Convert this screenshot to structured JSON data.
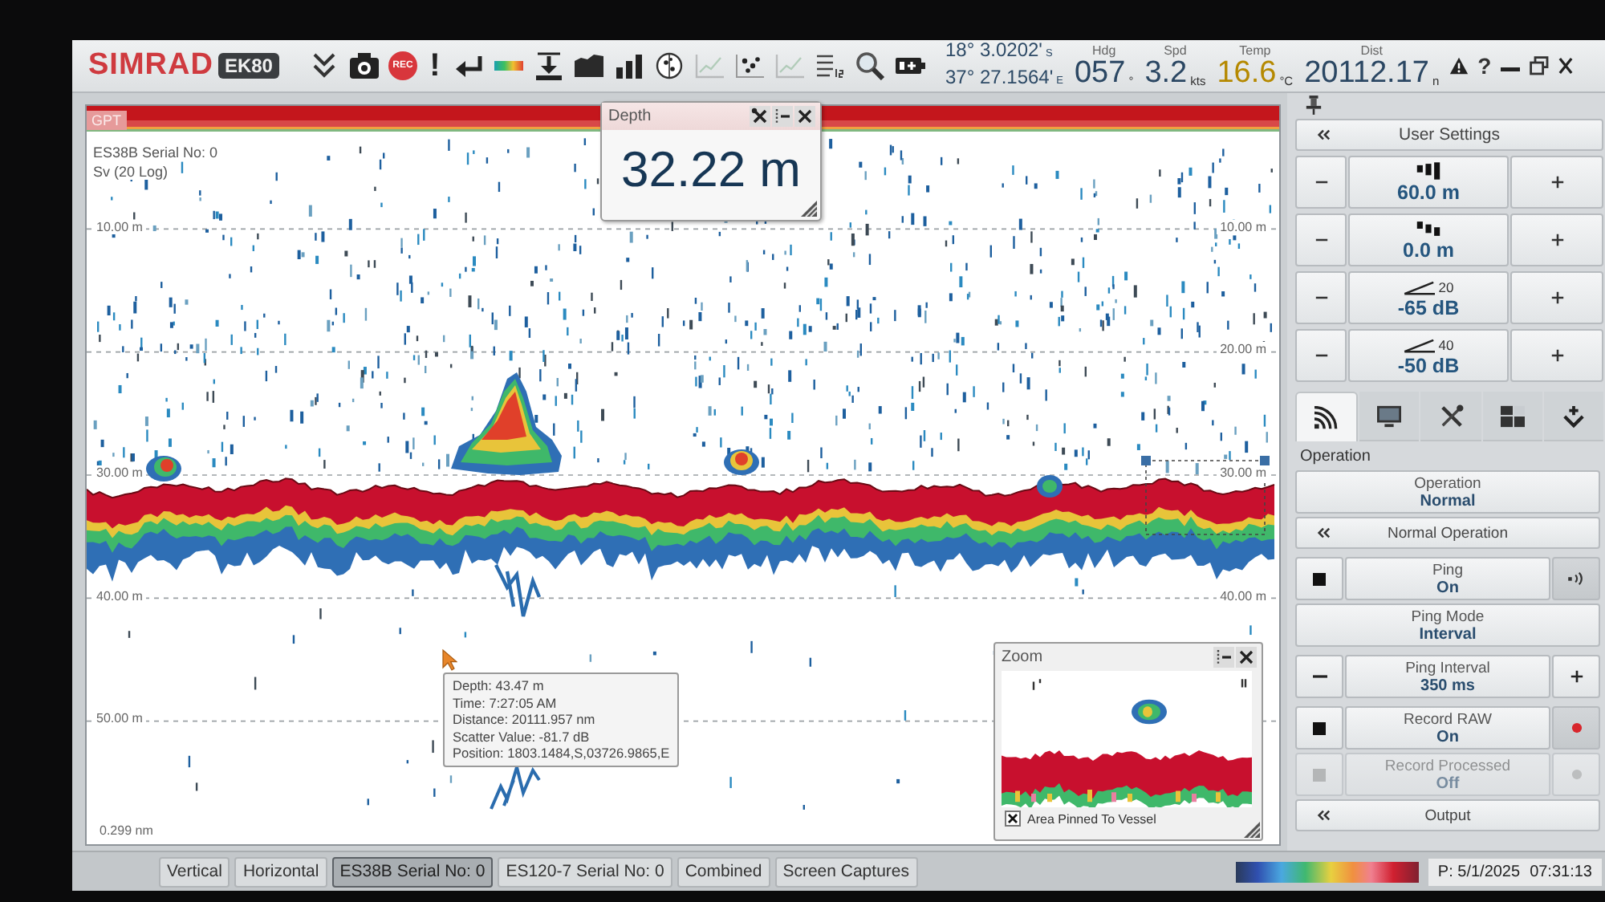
{
  "toolbar": {
    "brand": "SIMRAD",
    "product": "EK80",
    "buttons": [
      {
        "kind": "collapse",
        "disabled": false
      },
      {
        "kind": "camera",
        "disabled": false
      },
      {
        "kind": "record",
        "label": "REC",
        "disabled": false
      },
      {
        "kind": "alarm",
        "label": "!",
        "disabled": false
      },
      {
        "kind": "return",
        "disabled": false
      },
      {
        "kind": "colors",
        "disabled": false
      },
      {
        "kind": "bottom",
        "disabled": false
      },
      {
        "kind": "echogram",
        "disabled": false
      },
      {
        "kind": "histogram",
        "disabled": false
      },
      {
        "kind": "targets",
        "disabled": false
      },
      {
        "kind": "graph",
        "disabled": true
      },
      {
        "kind": "scatter",
        "disabled": false
      },
      {
        "kind": "graph",
        "disabled": true
      },
      {
        "kind": "numbers",
        "disabled": false
      },
      {
        "kind": "search",
        "disabled": false
      },
      {
        "kind": "battery",
        "disabled": false
      }
    ]
  },
  "navigation": {
    "latitude": "18° 3.0202'",
    "latitude_hemisphere": "S",
    "longitude": "37° 27.1564'",
    "longitude_hemisphere": "E",
    "readouts": [
      {
        "label": "Hdg",
        "value": "057",
        "unit": "°",
        "color": "#2b4763"
      },
      {
        "label": "Spd",
        "value": "3.2",
        "unit": "kts",
        "color": "#2b4763"
      },
      {
        "label": "Temp",
        "value": "16.6",
        "unit": "°C",
        "color": "#b58900"
      },
      {
        "label": "Dist",
        "value": "20112.17",
        "unit": "n",
        "color": "#2b4763"
      }
    ]
  },
  "window_controls": {
    "help": "?"
  },
  "echogram": {
    "tag": "GPT",
    "transducer": "ES38B Serial No: 0",
    "variable": "Sv (20 Log)",
    "depth_lines": [
      {
        "left": "10.00 m",
        "right": "10.00 m"
      },
      {
        "right": "20.00 m"
      },
      {
        "left": "30.00 m",
        "right": "30.00 m"
      },
      {
        "left": "40.00 m",
        "right": "40.00 m"
      },
      {
        "left": "50.00 m"
      }
    ],
    "distance_label": "0.299 nm",
    "depth_window": {
      "title": "Depth",
      "value": "32.22 m"
    },
    "tooltip": [
      "Depth: 43.47 m",
      "Time: 7:27:05 AM",
      "Distance: 20111.957 nm",
      "Scatter Value: -81.7 dB",
      "Position: 1803.1484,S,03726.9865,E"
    ],
    "zoom_window": {
      "title": "Zoom",
      "pinned": true,
      "pinned_label": "Area Pinned To Vessel"
    }
  },
  "side_panel": {
    "header": "User Settings",
    "steppers": [
      {
        "kind": "range",
        "value": "60.0 m"
      },
      {
        "kind": "start",
        "value": "0.0 m"
      },
      {
        "kind": "tvg",
        "exponent": "20",
        "value": "-65 dB"
      },
      {
        "kind": "tvg",
        "exponent": "40",
        "value": "-50 dB"
      }
    ],
    "tabs": [
      {
        "kind": "signal",
        "selected": true
      },
      {
        "kind": "display",
        "selected": false
      },
      {
        "kind": "tools",
        "selected": false
      },
      {
        "kind": "layout",
        "selected": false
      },
      {
        "kind": "install",
        "selected": false
      }
    ],
    "section": "Operation",
    "controls": [
      {
        "kind": "value",
        "label": "Operation",
        "value": "Normal",
        "disabled": false
      },
      {
        "kind": "expand",
        "label": "Normal Operation",
        "disabled": false
      },
      {
        "kind": "sound",
        "label": "Ping",
        "value": "On",
        "disabled": false
      },
      {
        "kind": "value",
        "label": "Ping Mode",
        "value": "Interval",
        "disabled": false
      },
      {
        "kind": "stepper",
        "label": "Ping Interval",
        "value": "350 ms",
        "disabled": false
      },
      {
        "kind": "record",
        "label": "Record RAW",
        "value": "On",
        "disabled": false
      },
      {
        "kind": "record",
        "label": "Record Processed",
        "value": "Off",
        "disabled": true
      },
      {
        "kind": "expand",
        "label": "Output",
        "disabled": false
      }
    ]
  },
  "bottom_bar": {
    "tabs": [
      {
        "label": "Vertical",
        "selected": false
      },
      {
        "label": "Horizontal",
        "selected": false
      },
      {
        "label": "ES38B Serial No: 0",
        "selected": true
      },
      {
        "label": "ES120-7 Serial No: 0",
        "selected": false
      },
      {
        "label": "Combined",
        "selected": false
      },
      {
        "label": "Screen Captures",
        "selected": false
      }
    ],
    "date": "P: 5/1/2025",
    "time": "07:31:13"
  }
}
